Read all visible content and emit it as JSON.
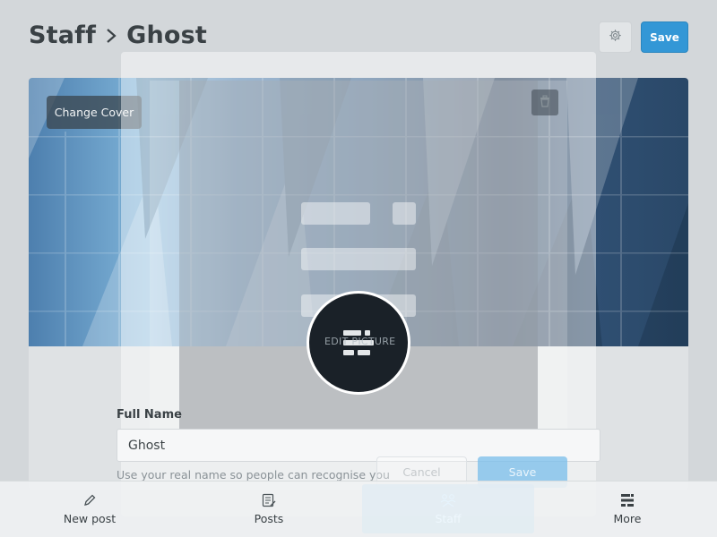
{
  "breadcrumb": {
    "parent": "Staff",
    "current": "Ghost"
  },
  "header": {
    "settings_icon": "gear-icon",
    "save_label": "Save"
  },
  "cover": {
    "change_cover_label": "Change Cover"
  },
  "profile": {
    "full_name_label": "Full Name",
    "full_name_value": "Ghost",
    "full_name_help": "Use your real name so people can recognise you"
  },
  "modal": {
    "edit_picture_label": "EDIT PICTURE",
    "cancel_label": "Cancel",
    "save_label": "Save",
    "trash_icon": "trash-icon"
  },
  "bottom_nav": {
    "items": [
      {
        "label": "New post",
        "icon": "pen-icon"
      },
      {
        "label": "Posts",
        "icon": "posts-icon"
      },
      {
        "label": "Staff",
        "icon": "staff-icon",
        "active": true
      },
      {
        "label": "More",
        "icon": "more-icon"
      }
    ]
  },
  "colors": {
    "accent": "#3397d6",
    "nav_active": "#63b7ee",
    "page_bg": "#d3d7da"
  }
}
